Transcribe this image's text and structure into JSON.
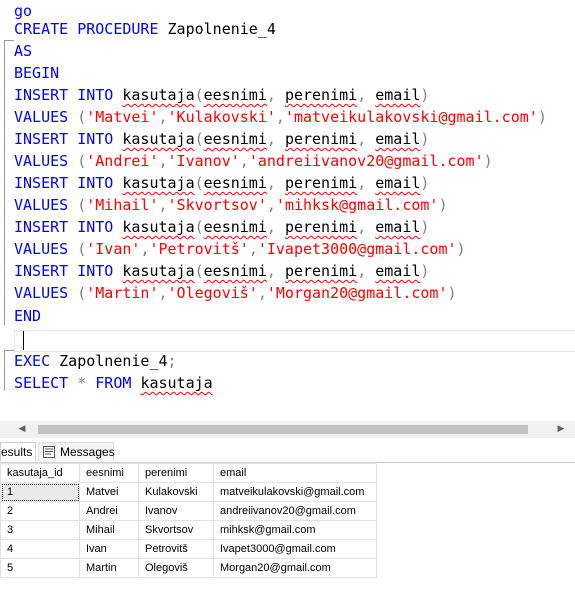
{
  "editor": {
    "lines": [
      {
        "id": "go",
        "parts": [
          {
            "t": "go",
            "c": "kw"
          }
        ]
      },
      {
        "id": "create",
        "parts": [
          {
            "t": "CREATE PROCEDURE ",
            "c": "kw"
          },
          {
            "t": "Zapolnenie_4",
            "c": ""
          }
        ]
      },
      {
        "id": "as",
        "parts": [
          {
            "t": "AS",
            "c": "kw"
          }
        ]
      },
      {
        "id": "begin",
        "parts": [
          {
            "t": "BEGIN",
            "c": "kw"
          }
        ]
      },
      {
        "id": "insert1",
        "parts": [
          {
            "t": "INSERT INTO ",
            "c": "kw"
          },
          {
            "t": "kasutaja",
            "c": "squig"
          },
          {
            "t": "(",
            "c": "gray"
          },
          {
            "t": "eesnimi",
            "c": "squig"
          },
          {
            "t": ", ",
            "c": "gray"
          },
          {
            "t": "perenimi",
            "c": "squig"
          },
          {
            "t": ", ",
            "c": "gray"
          },
          {
            "t": "email",
            "c": "squig"
          },
          {
            "t": ")",
            "c": "gray"
          }
        ]
      },
      {
        "id": "values1",
        "parts": [
          {
            "t": "VALUES ",
            "c": "kw"
          },
          {
            "t": "(",
            "c": "gray"
          },
          {
            "t": "'Matvei'",
            "c": "str"
          },
          {
            "t": ",",
            "c": "gray"
          },
          {
            "t": "'Kulakovski'",
            "c": "str"
          },
          {
            "t": ",",
            "c": "gray"
          },
          {
            "t": "'matveikulakovski@gmail.com'",
            "c": "str"
          },
          {
            "t": ")",
            "c": "gray"
          }
        ]
      },
      {
        "id": "insert2",
        "parts": [
          {
            "t": "INSERT INTO ",
            "c": "kw"
          },
          {
            "t": "kasutaja",
            "c": "squig"
          },
          {
            "t": "(",
            "c": "gray"
          },
          {
            "t": "eesnimi",
            "c": "squig"
          },
          {
            "t": ", ",
            "c": "gray"
          },
          {
            "t": "perenimi",
            "c": "squig"
          },
          {
            "t": ", ",
            "c": "gray"
          },
          {
            "t": "email",
            "c": "squig"
          },
          {
            "t": ")",
            "c": "gray"
          }
        ]
      },
      {
        "id": "values2",
        "parts": [
          {
            "t": "VALUES ",
            "c": "kw"
          },
          {
            "t": "(",
            "c": "gray"
          },
          {
            "t": "'Andrei'",
            "c": "str"
          },
          {
            "t": ",",
            "c": "gray"
          },
          {
            "t": "'Ivanov'",
            "c": "str"
          },
          {
            "t": ",",
            "c": "gray"
          },
          {
            "t": "'andreiivanov20@gmail.com'",
            "c": "str"
          },
          {
            "t": ")",
            "c": "gray"
          }
        ]
      },
      {
        "id": "insert3",
        "parts": [
          {
            "t": "INSERT INTO ",
            "c": "kw"
          },
          {
            "t": "kasutaja",
            "c": "squig"
          },
          {
            "t": "(",
            "c": "gray"
          },
          {
            "t": "eesnimi",
            "c": "squig"
          },
          {
            "t": ", ",
            "c": "gray"
          },
          {
            "t": "perenimi",
            "c": "squig"
          },
          {
            "t": ", ",
            "c": "gray"
          },
          {
            "t": "email",
            "c": "squig"
          },
          {
            "t": ")",
            "c": "gray"
          }
        ]
      },
      {
        "id": "values3",
        "parts": [
          {
            "t": "VALUES ",
            "c": "kw"
          },
          {
            "t": "(",
            "c": "gray"
          },
          {
            "t": "'Mihail'",
            "c": "str"
          },
          {
            "t": ",",
            "c": "gray"
          },
          {
            "t": "'Skvortsov'",
            "c": "str"
          },
          {
            "t": ",",
            "c": "gray"
          },
          {
            "t": "'mihksk@gmail.com'",
            "c": "str"
          },
          {
            "t": ")",
            "c": "gray"
          }
        ]
      },
      {
        "id": "insert4",
        "parts": [
          {
            "t": "INSERT INTO ",
            "c": "kw"
          },
          {
            "t": "kasutaja",
            "c": "squig"
          },
          {
            "t": "(",
            "c": "gray"
          },
          {
            "t": "eesnimi",
            "c": "squig"
          },
          {
            "t": ", ",
            "c": "gray"
          },
          {
            "t": "perenimi",
            "c": "squig"
          },
          {
            "t": ", ",
            "c": "gray"
          },
          {
            "t": "email",
            "c": "squig"
          },
          {
            "t": ")",
            "c": "gray"
          }
        ]
      },
      {
        "id": "values4",
        "parts": [
          {
            "t": "VALUES ",
            "c": "kw"
          },
          {
            "t": "(",
            "c": "gray"
          },
          {
            "t": "'Ivan'",
            "c": "str"
          },
          {
            "t": ",",
            "c": "gray"
          },
          {
            "t": "'Petrovitš'",
            "c": "str"
          },
          {
            "t": ",",
            "c": "gray"
          },
          {
            "t": "'Ivapet3000@gmail.com'",
            "c": "str"
          },
          {
            "t": ")",
            "c": "gray"
          }
        ]
      },
      {
        "id": "insert5",
        "parts": [
          {
            "t": "INSERT INTO ",
            "c": "kw"
          },
          {
            "t": "kasutaja",
            "c": "squig"
          },
          {
            "t": "(",
            "c": "gray"
          },
          {
            "t": "eesnimi",
            "c": "squig"
          },
          {
            "t": ", ",
            "c": "gray"
          },
          {
            "t": "perenimi",
            "c": "squig"
          },
          {
            "t": ", ",
            "c": "gray"
          },
          {
            "t": "email",
            "c": "squig"
          },
          {
            "t": ")",
            "c": "gray"
          }
        ]
      },
      {
        "id": "values5",
        "parts": [
          {
            "t": "VALUES ",
            "c": "kw"
          },
          {
            "t": "(",
            "c": "gray"
          },
          {
            "t": "'Martin'",
            "c": "str"
          },
          {
            "t": ",",
            "c": "gray"
          },
          {
            "t": "'Olegoviš'",
            "c": "str"
          },
          {
            "t": ",",
            "c": "gray"
          },
          {
            "t": "'Morgan20@gmail.com'",
            "c": "str"
          },
          {
            "t": ")",
            "c": "gray"
          }
        ]
      },
      {
        "id": "end",
        "parts": [
          {
            "t": "END",
            "c": "kw"
          }
        ]
      },
      {
        "id": "blank",
        "parts": []
      },
      {
        "id": "exec",
        "parts": [
          {
            "t": "EXEC ",
            "c": "kw"
          },
          {
            "t": "Zapolnenie_4",
            "c": ""
          },
          {
            "t": ";",
            "c": "gray"
          }
        ]
      },
      {
        "id": "select",
        "parts": [
          {
            "t": "SELECT ",
            "c": "kw"
          },
          {
            "t": "* ",
            "c": "gray"
          },
          {
            "t": "FROM ",
            "c": "kw"
          },
          {
            "t": "kasutaja",
            "c": "squig"
          }
        ]
      }
    ]
  },
  "tabs": {
    "results_label": "Results",
    "results_visible": "esults",
    "messages_label": "Messages"
  },
  "grid": {
    "columns": [
      "kasutaja_id",
      "eesnimi",
      "perenimi",
      "email"
    ],
    "rows": [
      [
        "1",
        "Matvei",
        "Kulakovski",
        "matveikulakovski@gmail.com"
      ],
      [
        "2",
        "Andrei",
        "Ivanov",
        "andreiivanov20@gmail.com"
      ],
      [
        "3",
        "Mihail",
        "Skvortsov",
        "mihksk@gmail.com"
      ],
      [
        "4",
        "Ivan",
        "Petrovitš",
        "Ivapet3000@gmail.com"
      ],
      [
        "5",
        "Martin",
        "Olegoviš",
        "Morgan20@gmail.com"
      ]
    ]
  },
  "colors": {
    "keyword": "#0000ff",
    "string": "#ff0000",
    "punct": "#808080"
  }
}
